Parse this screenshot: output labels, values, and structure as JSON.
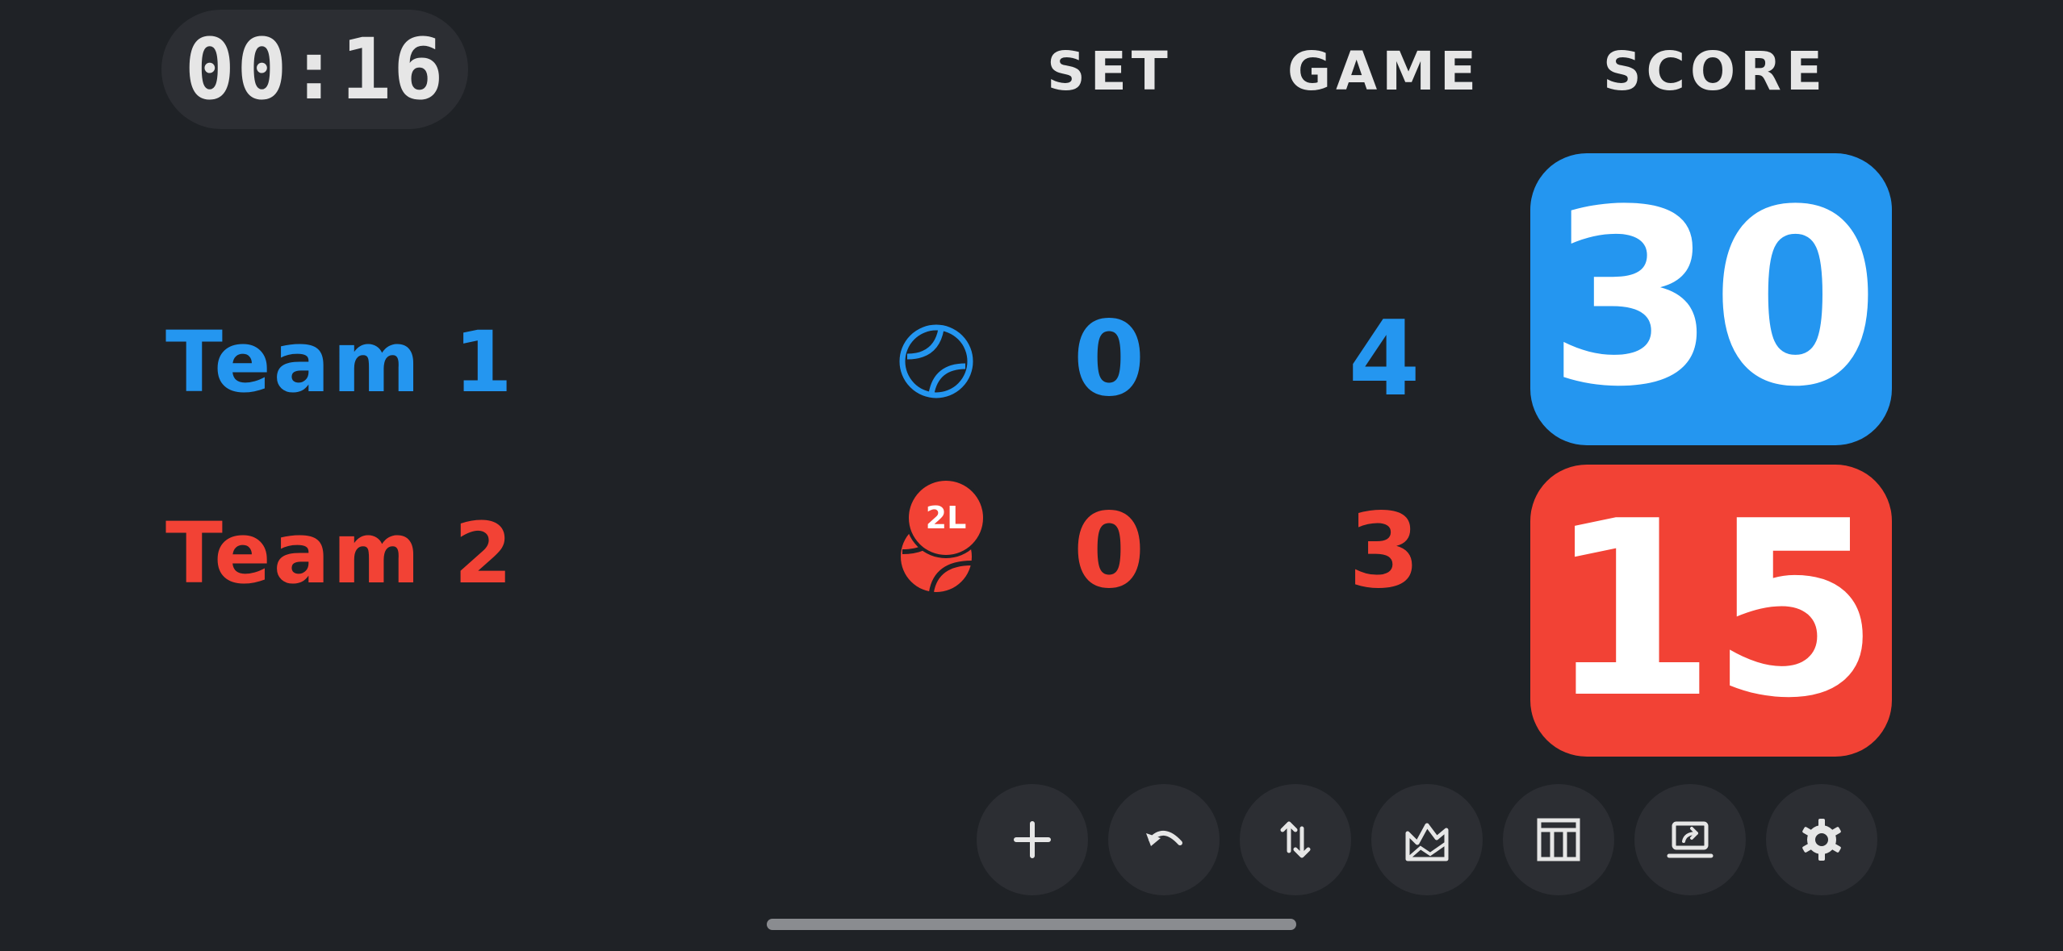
{
  "timer": {
    "text": "00:16"
  },
  "headers": {
    "set": "SET",
    "game": "GAME",
    "score": "SCORE"
  },
  "teams": [
    {
      "name": "Team 1",
      "set": "0",
      "game": "4",
      "score": "30",
      "color": "#2496f0",
      "indicator_icon": "tennis-ball-icon"
    },
    {
      "name": "Team 2",
      "set": "0",
      "game": "3",
      "score": "15",
      "color": "#f24235",
      "indicator_icon": "tennis-ball-icon",
      "serve_badge": "2L"
    }
  ],
  "toolbar": {
    "buttons": [
      {
        "icon": "plus-icon"
      },
      {
        "icon": "undo-icon"
      },
      {
        "icon": "swap-icon"
      },
      {
        "icon": "chart-icon"
      },
      {
        "icon": "table-icon"
      },
      {
        "icon": "share-screen-icon"
      },
      {
        "icon": "gear-icon"
      }
    ]
  },
  "colors": {
    "background": "#1f2226",
    "button": "#2c2e33",
    "text": "#e6e6e6"
  }
}
